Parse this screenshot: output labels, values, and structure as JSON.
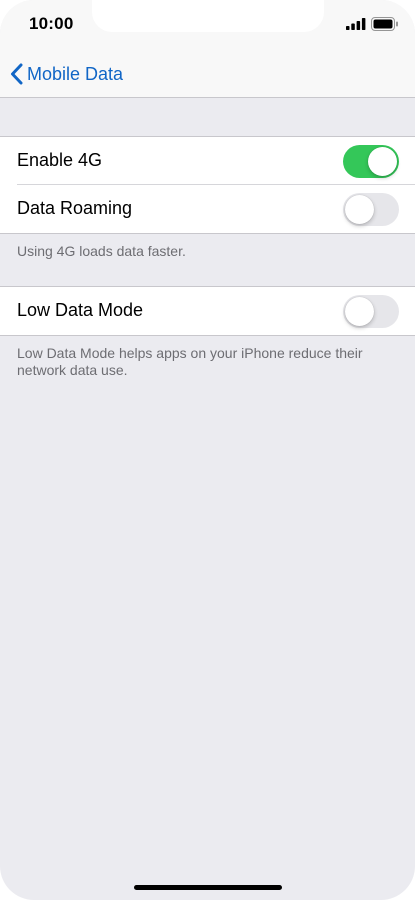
{
  "status_bar": {
    "time": "10:00"
  },
  "icons": {
    "signal": "signal-bars-icon",
    "battery": "battery-icon",
    "back": "chevron-left-icon"
  },
  "colors": {
    "accent": "#1166c6",
    "toggle_on": "#34c759",
    "toggle_off": "#e6e6ea",
    "background": "#ebebf0"
  },
  "nav": {
    "back_label": "Mobile Data"
  },
  "settings": {
    "group1": {
      "rows": [
        {
          "label": "Enable 4G",
          "enabled": true
        },
        {
          "label": "Data Roaming",
          "enabled": false
        }
      ],
      "footer": "Using 4G loads data faster."
    },
    "group2": {
      "rows": [
        {
          "label": "Low Data Mode",
          "enabled": false
        }
      ],
      "footer": "Low Data Mode helps apps on your iPhone reduce their network data use."
    }
  }
}
